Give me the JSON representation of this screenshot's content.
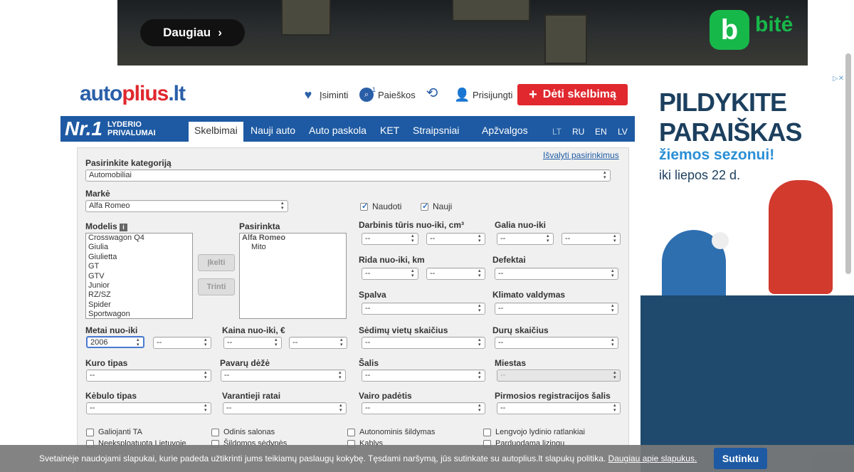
{
  "top_ad": {
    "button_label": "Daugiau",
    "brand": "bitė",
    "logo_letter": "b"
  },
  "header": {
    "logo_left": "auto",
    "logo_plus": "plius",
    "logo_right": ".lt",
    "links": [
      {
        "label": "Įsiminti",
        "icon": "heart-icon"
      },
      {
        "label": "Paieškos",
        "icon": "saved-search-icon",
        "badge": "1"
      },
      {
        "label": "",
        "icon": "history-icon"
      },
      {
        "label": "Prisijungti",
        "icon": "user-icon"
      }
    ],
    "post_button": "Dėti skelbimą"
  },
  "nav": {
    "nr1": "Nr.1",
    "nr1_sub1": "LYDERIO",
    "nr1_sub2": "PRIVALUMAI",
    "tabs": [
      "Skelbimai",
      "Nauji auto",
      "Auto paskola",
      "KET",
      "Straipsniai",
      "Apžvalgos"
    ],
    "active_tab": "Skelbimai",
    "languages": [
      "LT",
      "RU",
      "EN",
      "LV"
    ],
    "active_language": "LT"
  },
  "form": {
    "clear_link": "Išvalyti pasirinkimus",
    "category_label": "Pasirinkite kategoriją",
    "category_value": "Automobiliai",
    "make_label": "Markė",
    "make_value": "Alfa Romeo",
    "used_label": "Naudoti",
    "new_label": "Nauji",
    "model_label": "Modelis",
    "models": [
      "Crosswagon Q4",
      "Giulia",
      "Giulietta",
      "GT",
      "GTV",
      "Junior",
      "RZ/SZ",
      "Spider",
      "Sportwagon"
    ],
    "selected_label": "Pasirinkta",
    "selected_make": "Alfa Romeo",
    "selected_model": "Mito",
    "add_button": "Įkelti",
    "remove_button": "Trinti",
    "engine_label": "Darbinis tūris nuo-iki, cm³",
    "power_label": "Galia nuo-iki",
    "mileage_label": "Rida nuo-iki, km",
    "defects_label": "Defektai",
    "color_label": "Spalva",
    "climate_label": "Klimato valdymas",
    "year_label": "Metai nuo-iki",
    "year_from": "2006",
    "price_label": "Kaina nuo-iki, €",
    "seats_label": "Sėdimų vietų skaičius",
    "doors_label": "Durų skaičius",
    "fuel_label": "Kuro tipas",
    "gearbox_label": "Pavarų dėžė",
    "country_label": "Šalis",
    "city_label": "Miestas",
    "body_label": "Kėbulo tipas",
    "drive_label": "Varantieji ratai",
    "steering_label": "Vairo padėtis",
    "reg_country_label": "Pirmosios registracijos šalis",
    "placeholder": "--",
    "checkboxes_row1": [
      "Galiojanti TA",
      "Odinis salonas",
      "Autonominis šildymas",
      "Lengvojo lydinio ratlankiai"
    ],
    "checkboxes_row2": [
      "Neeksploatuota Lietuvoje",
      "Šildomos sėdynės",
      "Kablys",
      "Parduodama lizingu"
    ]
  },
  "side_ad": {
    "line1": "PILDYKITE",
    "line2": "PARAIŠKAS",
    "line3": "žiemos sezonui!",
    "line4": "iki liepos 22 d."
  },
  "cookie": {
    "text": "Svetainėje naudojami slapukai, kurie padeda užtikrinti jums teikiamų paslaugų kokybę. Tęsdami naršymą, jūs sutinkate su autoplius.lt slapukų politika.",
    "link": "Daugiau apie slapukus.",
    "button": "Sutinku"
  },
  "colors": {
    "brand_blue": "#1e5aa3",
    "brand_red": "#e0282e",
    "bite_green": "#17b84a"
  }
}
